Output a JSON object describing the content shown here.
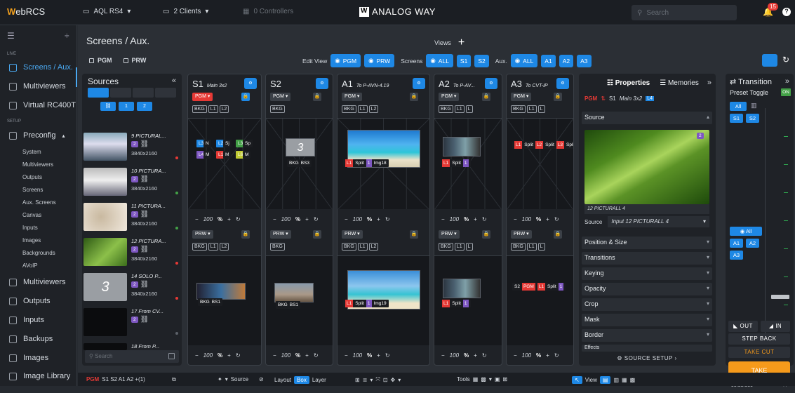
{
  "topbar": {
    "logo_prefix": "W",
    "logo_text": "ebRCS",
    "device": "AQL RS4",
    "clients": "2 Clients",
    "controllers": "0 Controllers",
    "brand": "ANALOG WAY",
    "search_placeholder": "Search",
    "notifications": "15"
  },
  "sidebar": {
    "live_header": "LIVE",
    "setup_header": "SETUP",
    "items": [
      {
        "label": "Screens / Aux."
      },
      {
        "label": "Multiviewers"
      },
      {
        "label": "Virtual RC400T"
      },
      {
        "label": "Preconfig"
      },
      {
        "label": "Multiviewers"
      },
      {
        "label": "Outputs"
      },
      {
        "label": "Inputs"
      },
      {
        "label": "Backups"
      },
      {
        "label": "Images"
      },
      {
        "label": "Image Library"
      }
    ],
    "sub_items": [
      "System",
      "Multiviewers",
      "Outputs",
      "Screens",
      "Aux. Screens",
      "Canvas",
      "Inputs",
      "Images",
      "Backgrounds",
      "AVoIP"
    ]
  },
  "header": {
    "title": "Screens / Aux.",
    "views_label": "Views",
    "pgm_label": "PGM",
    "prw_label": "PRW",
    "edit_view_label": "Edit View",
    "edit_pgm": "PGM",
    "edit_prw": "PRW",
    "screens_label": "Screens",
    "screens_all": "ALL",
    "screens_s1": "S1",
    "screens_s2": "S2",
    "aux_label": "Aux.",
    "aux_all": "ALL",
    "aux_a1": "A1",
    "aux_a2": "A2",
    "aux_a3": "A3"
  },
  "sources": {
    "title": "Sources",
    "filter_1": "1",
    "filter_2": "2",
    "search_placeholder": "Search",
    "items": [
      {
        "name": "9 PICTURAL...",
        "badge": "2",
        "res": "3840x2160"
      },
      {
        "name": "10 PICTURA...",
        "badge": "2",
        "res": "3840x2160"
      },
      {
        "name": "11 PICTURA...",
        "badge": "2",
        "res": "3840x2160"
      },
      {
        "name": "12 PICTURA...",
        "badge": "2",
        "res": "3840x2160"
      },
      {
        "name": "14 SOLO P...",
        "badge": "2",
        "res": "3840x2160"
      },
      {
        "name": "17 From CV...",
        "badge": "2",
        "res": ""
      },
      {
        "name": "18 From P...",
        "badge": "",
        "res": ""
      }
    ]
  },
  "screens": [
    {
      "id": "S1",
      "sub": "Main 3x2",
      "pgm": "PGM",
      "prw": "PRW",
      "layers": [
        "BKG",
        "L1",
        "L2"
      ],
      "zoom": "100",
      "pct": "%",
      "prw_zoom": "100",
      "pgm_tags": [
        "L3",
        "N",
        "L2",
        "Sj",
        "L3",
        "Sp",
        "L4",
        "M",
        "L1",
        "M",
        "L6",
        "M"
      ]
    },
    {
      "id": "S2",
      "sub": "",
      "pgm": "PGM",
      "prw": "PRW",
      "layers": [
        "BKG"
      ],
      "zoom": "100",
      "pct": "%",
      "prw_zoom": "100",
      "pgm_tags": [
        "BKG",
        "BS3"
      ],
      "prw_tags": [
        "BKG",
        "BS1"
      ]
    },
    {
      "id": "A1",
      "sub": "To P-AVN-4.19",
      "pgm": "PGM",
      "prw": "PRW",
      "layers": [
        "BKG",
        "L1",
        "L2"
      ],
      "zoom": "100",
      "pct": "%",
      "prw_zoom": "100",
      "pgm_tags": [
        "L1",
        "Split",
        "1",
        "Img18"
      ],
      "prw_tags": [
        "L1",
        "Split",
        "1",
        "Img19"
      ]
    },
    {
      "id": "A2",
      "sub": "To P-AV...",
      "pgm": "PGM",
      "prw": "PRW",
      "layers": [
        "BKG",
        "L1",
        "L"
      ],
      "zoom": "100",
      "pct": "%",
      "prw_zoom": "100",
      "pgm_tags": [
        "L1",
        "Split",
        "1"
      ],
      "prw_tags": [
        "L1",
        "Split",
        "1"
      ]
    },
    {
      "id": "A3",
      "sub": "To CVT-IP",
      "pgm": "PGM",
      "prw": "PRW",
      "layers": [
        "BKG",
        "L1",
        "L"
      ],
      "zoom": "100",
      "pct": "%",
      "prw_zoom": "100",
      "pgm_tags": [
        "L1",
        "Split",
        "L2",
        "Split",
        "L3",
        "Split"
      ],
      "prw_tags": [
        "S2",
        "PGM",
        "L1",
        "Split",
        "1"
      ]
    }
  ],
  "properties": {
    "tab_properties": "Properties",
    "tab_memories": "Memories",
    "pgm": "PGM",
    "screen": "S1",
    "screen_sub": "Main 3x2",
    "layer": "L4",
    "source_section": "Source",
    "source_badge": "2",
    "caption": "12 PICTURALL 4",
    "source_label": "Source",
    "source_value": "Input 12 PICTURALL 4",
    "sections": [
      "Position & Size",
      "Transitions",
      "Keying",
      "Opacity",
      "Crop",
      "Mask",
      "Border",
      "Effects"
    ],
    "setup": "SOURCE SETUP"
  },
  "transition": {
    "title": "Transition",
    "mode": "Preset Toggle",
    "on": "ON",
    "all": "All",
    "s1": "S1",
    "s2": "S2",
    "aux_all": "All",
    "a1": "A1",
    "a2": "A2",
    "a3": "A3",
    "out": "OUT",
    "in": "IN",
    "step_back": "STEP BACK",
    "take_cut": "TAKE CUT",
    "take": "TAKE",
    "duration": "00:01.000"
  },
  "bottombar": {
    "pgm_selection": "PGM",
    "selection": "S1 S2 A1 A2 +(1)",
    "source": "Source",
    "layout": "Layout",
    "box": "Box",
    "layer": "Layer",
    "tools": "Tools",
    "view": "View"
  }
}
